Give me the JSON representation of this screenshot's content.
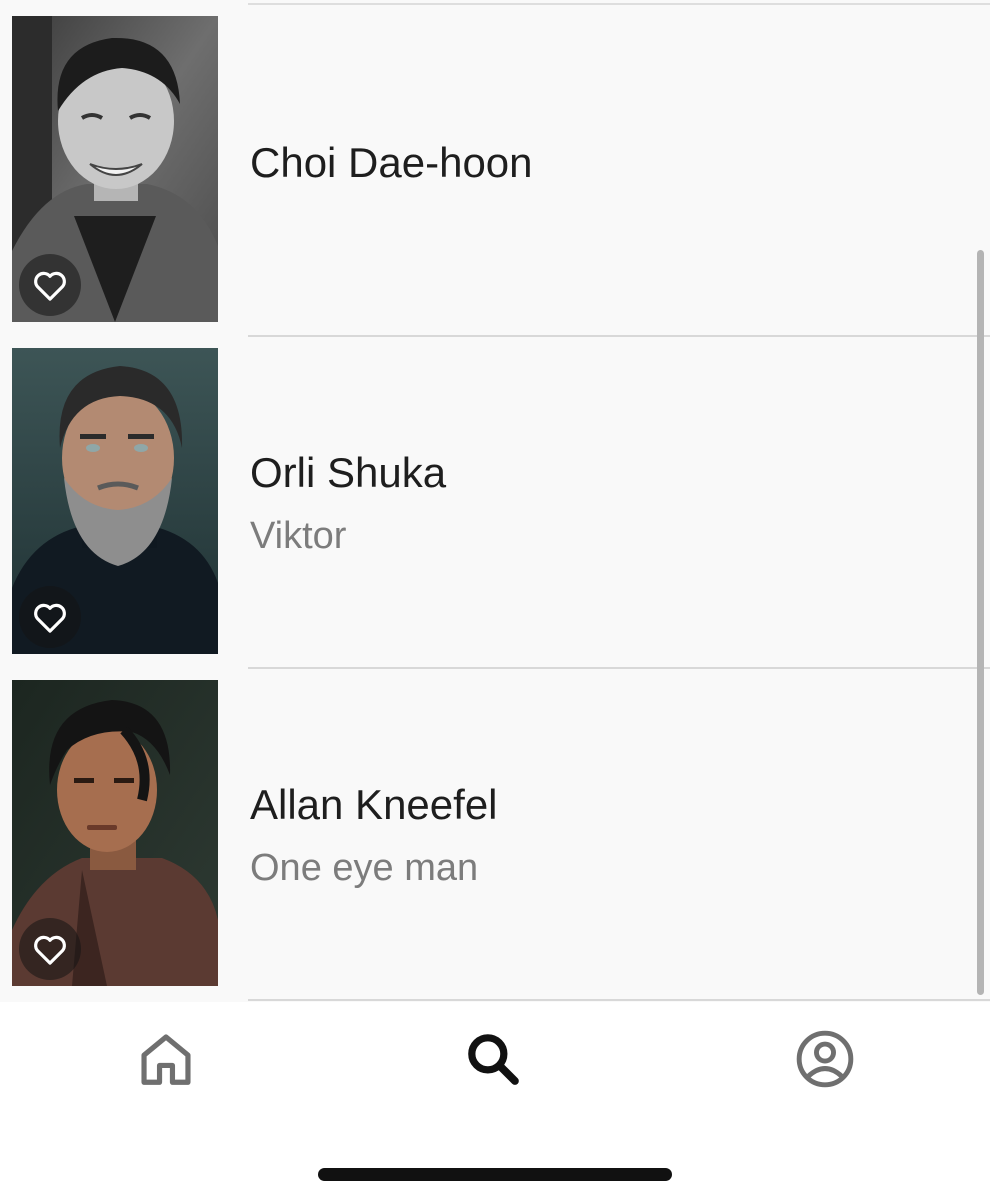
{
  "cast": [
    {
      "name": "Choi Dae-hoon",
      "role": "",
      "photo_icon": "person-photo",
      "favorite_icon": "heart-outline-icon"
    },
    {
      "name": "Orli Shuka",
      "role": "Viktor",
      "photo_icon": "person-photo",
      "favorite_icon": "heart-outline-icon"
    },
    {
      "name": "Allan Kneefel",
      "role": "One eye man",
      "photo_icon": "person-photo",
      "favorite_icon": "heart-outline-icon"
    }
  ],
  "tabbar": {
    "items": [
      {
        "id": "home",
        "icon": "home-icon",
        "active": false
      },
      {
        "id": "search",
        "icon": "search-icon",
        "active": true
      },
      {
        "id": "profile",
        "icon": "profile-icon",
        "active": false
      }
    ]
  },
  "colors": {
    "list_background": "#f9f9f9",
    "name_text": "#1e1e1e",
    "role_text": "#7c7c7c",
    "active_tab": "#111111",
    "inactive_tab": "#6f6f6f"
  }
}
